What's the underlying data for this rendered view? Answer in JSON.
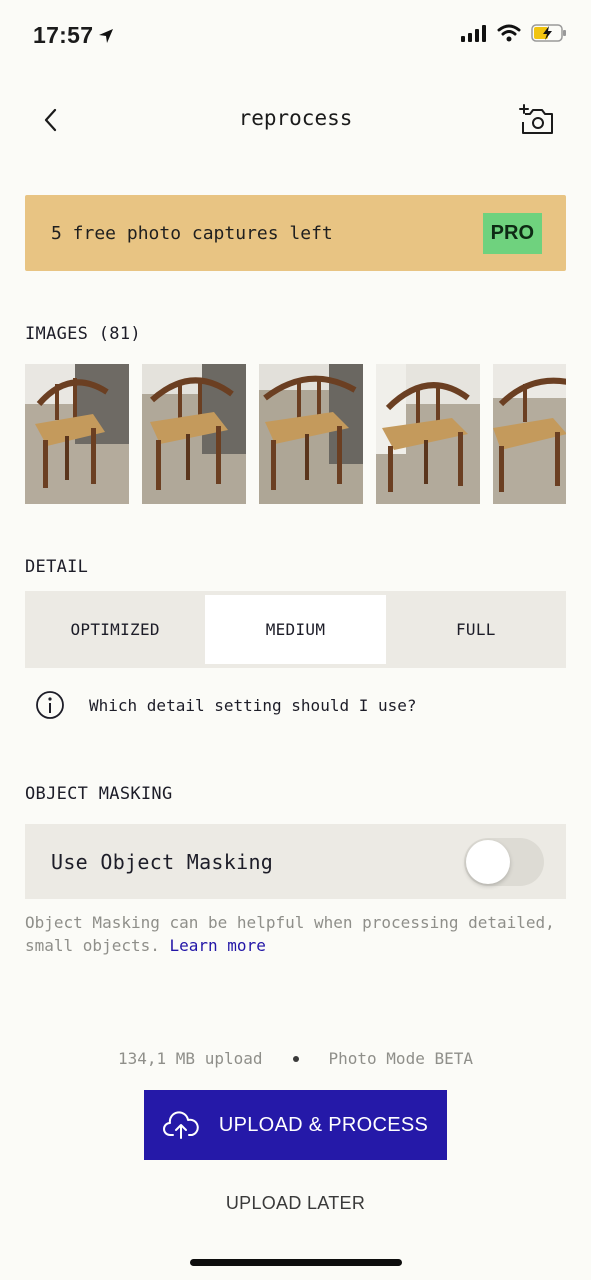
{
  "status_bar": {
    "time": "17:57"
  },
  "header": {
    "title": "reprocess"
  },
  "banner": {
    "text": "5 free photo captures left",
    "badge": "PRO",
    "badge_color": "#6fd27e",
    "bg_color": "#e8c483"
  },
  "images": {
    "label": "IMAGES (81)",
    "thumbnail_count_visible": 5
  },
  "detail": {
    "label": "DETAIL",
    "options": [
      "OPTIMIZED",
      "MEDIUM",
      "FULL"
    ],
    "selected": "MEDIUM",
    "help_text": "Which detail setting should I use?"
  },
  "masking": {
    "label": "OBJECT MASKING",
    "toggle_label": "Use Object Masking",
    "toggle_on": false,
    "description": "Object Masking can be helpful when processing detailed, small objects.",
    "learn_more": "Learn more"
  },
  "upload": {
    "size": "134,1 MB upload",
    "mode": "Photo Mode BETA",
    "primary_label": "UPLOAD & PROCESS",
    "secondary_label": "UPLOAD LATER",
    "accent_color": "#2519a8"
  }
}
